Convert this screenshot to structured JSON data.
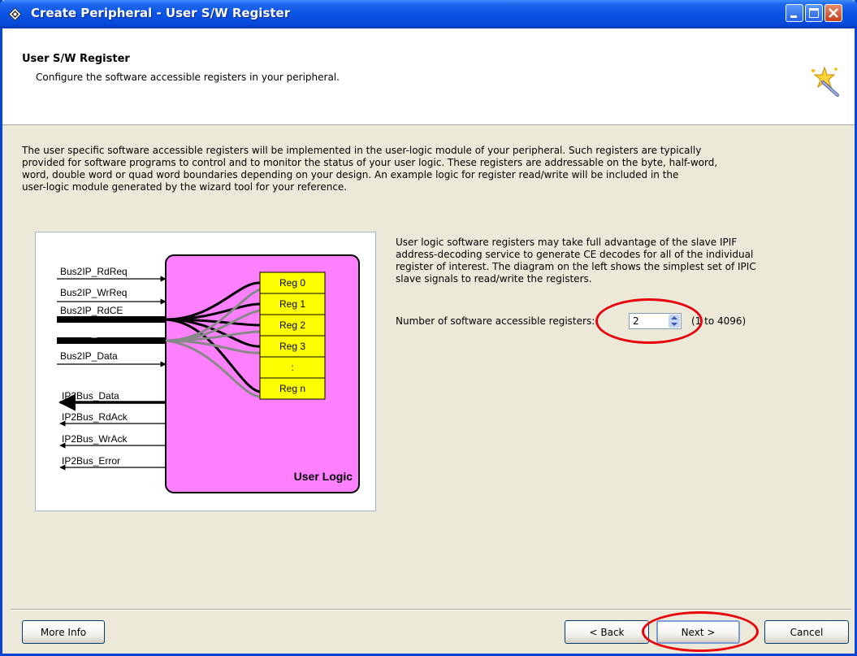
{
  "window": {
    "title": "Create Peripheral - User S/W Register"
  },
  "header": {
    "title": "User S/W Register",
    "subtitle": "Configure the software accessible registers in your peripheral."
  },
  "intro_lines": [
    "The user specific software accessible registers will be implemented in the user-logic module of your peripheral. Such registers are typically",
    "provided for software programs to control and to monitor the status of your user logic. These registers are addressable on the byte, half-word,",
    "word, double word or quad word boundaries depending on your design. An example logic for register read/write will be included in the",
    "user-logic module generated by the wizard tool for your reference."
  ],
  "description_lines": [
    "User logic software registers may take full advantage of the slave IPIF",
    "address-decoding service to generate CE decodes for all of the individual",
    "register of interest. The diagram on the left shows the simplest set of IPIC",
    "slave signals to read/write the registers."
  ],
  "register_count": {
    "label": "Number of software accessible registers:",
    "value": "2",
    "range": "(1 to 4096)"
  },
  "diagram": {
    "inputs": [
      "Bus2IP_RdReq",
      "Bus2IP_WrReq",
      "Bus2IP_RdCE",
      "Bus2IP_WrCE",
      "Bus2IP_Data"
    ],
    "outputs": [
      "IP2Bus_Data",
      "IP2Bus_RdAck",
      "IP2Bus_WrAck",
      "IP2Bus_Error"
    ],
    "registers": [
      "Reg 0",
      "Reg 1",
      "Reg 2",
      "Reg 3",
      ":",
      "Reg n"
    ],
    "block_label": "User Logic",
    "block_color": "#FF80FF",
    "register_color": "#FFFF00"
  },
  "buttons": {
    "more_info": "More Info",
    "back": "< Back",
    "next": "Next >",
    "cancel": "Cancel"
  },
  "annotation_color": "#E8000B"
}
